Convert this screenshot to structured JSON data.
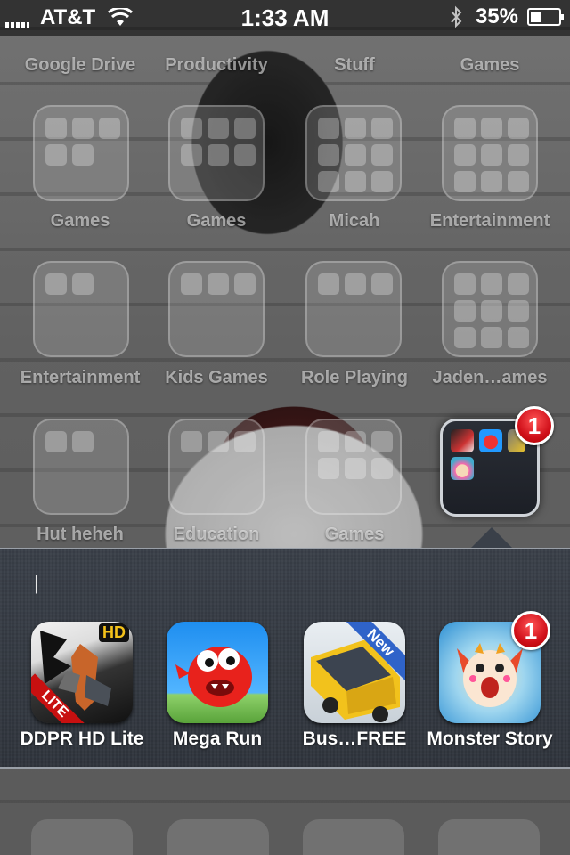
{
  "status_bar": {
    "carrier": "AT&T",
    "time": "1:33 AM",
    "battery_percent": "35%",
    "battery_level": 0.35
  },
  "folders": [
    {
      "label": "Google Drive"
    },
    {
      "label": "Productivity"
    },
    {
      "label": "Stuff"
    },
    {
      "label": "Games"
    },
    {
      "label": "Games"
    },
    {
      "label": "Games"
    },
    {
      "label": "Micah"
    },
    {
      "label": "Entertainment"
    },
    {
      "label": "Entertainment"
    },
    {
      "label": "Kids Games"
    },
    {
      "label": "Role Playing"
    },
    {
      "label": "Jaden…ames"
    },
    {
      "label": "Hut heheh"
    },
    {
      "label": "Education"
    },
    {
      "label": "Games"
    }
  ],
  "open_folder": {
    "badge": "1",
    "name_field": ""
  },
  "apps": [
    {
      "name": "DDPR HD Lite",
      "icon": "ddpr-hd-lite-icon",
      "badge": "",
      "corner_label": "HD",
      "ribbon": "LITE"
    },
    {
      "name": "Mega Run",
      "icon": "mega-run-icon",
      "badge": ""
    },
    {
      "name": "Bus…FREE",
      "icon": "bus-free-icon",
      "badge": "",
      "ribbon": "New"
    },
    {
      "name": "Monster Story",
      "icon": "monster-story-icon",
      "badge": "1"
    }
  ]
}
